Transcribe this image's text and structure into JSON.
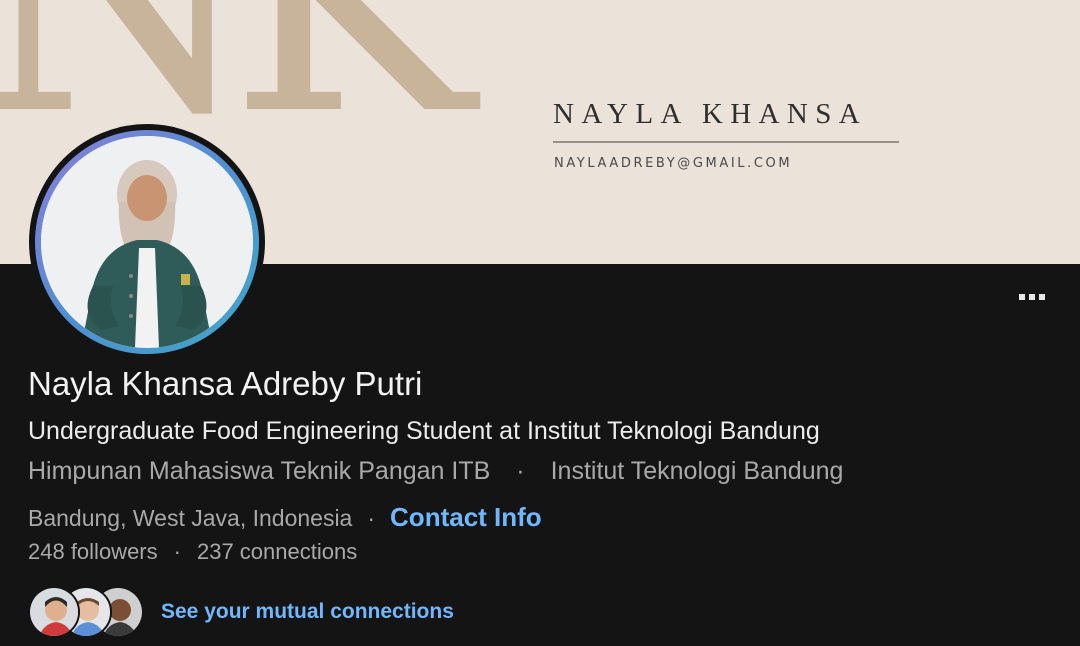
{
  "banner": {
    "monogram": "NK",
    "name": "NAYLA KHANSA",
    "email": "NAYLAADREBY@GMAIL.COM"
  },
  "profile": {
    "name": "Nayla Khansa Adreby Putri",
    "headline": "Undergraduate Food Engineering Student at Institut Teknologi Bandung",
    "affiliations": [
      "Himpunan Mahasiswa Teknik Pangan ITB",
      "Institut Teknologi Bandung"
    ],
    "separator": "·",
    "location": "Bandung, West Java, Indonesia",
    "contact_info_label": "Contact Info",
    "followers": "248 followers",
    "connections": "237 connections",
    "mutual_label": "See your mutual connections"
  },
  "icons": {
    "more": "more-horizontal-icon"
  },
  "colors": {
    "background": "#141414",
    "banner": "#ebe2d9",
    "link": "#71b7fb",
    "muted_text": "#a9a9a9"
  }
}
